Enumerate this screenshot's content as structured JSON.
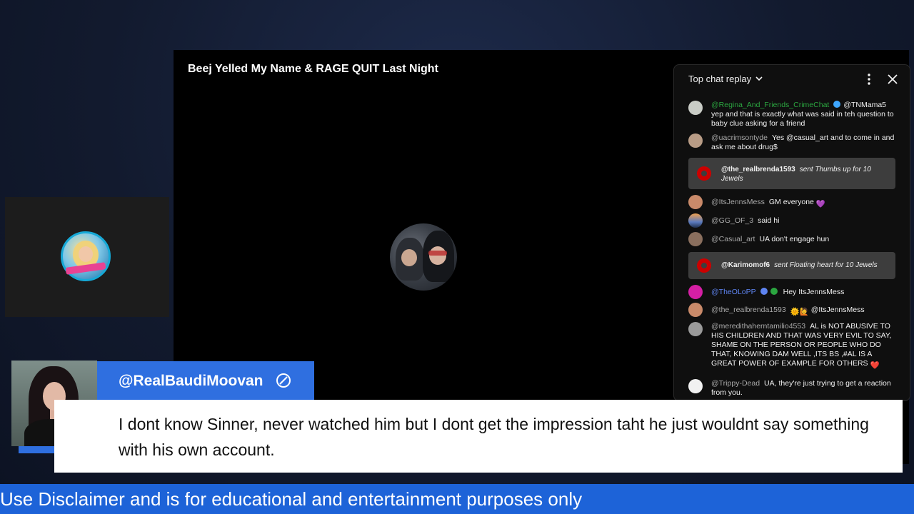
{
  "video": {
    "title": "Beej Yelled My Name & RAGE QUIT Last Night"
  },
  "chat": {
    "header_title": "Top chat replay",
    "header_icons": [
      "chevron-down-icon",
      "more-vert-icon",
      "close-icon"
    ],
    "messages": [
      {
        "author": "@Regina_And_Friends_CrimeChat",
        "text": "@TNMama5 yep and that is exactly what was said in teh question to baby clue asking for a friend"
      },
      {
        "author": "@uacrimsontyde",
        "text": "Yes @casual_art and to come in and ask me about drug$"
      },
      {
        "author": "@the_realbrenda1593",
        "text": "sent Thumbs up for 10 Jewels"
      },
      {
        "author": "@ItsJennsMess",
        "text": "GM everyone",
        "emoji": "💜"
      },
      {
        "author": "@GG_OF_3",
        "text": "said hi"
      },
      {
        "author": "@Casual_art",
        "text": "UA don't engage hun"
      },
      {
        "author": "@Karimomof6",
        "text": "sent Floating heart for 10 Jewels"
      },
      {
        "author": "@TheOLoPP",
        "text": "Hey ItsJennsMess"
      },
      {
        "author": "@the_realbrenda1593",
        "emoji": "🌞🙋",
        "text": "@ItsJennsMess"
      },
      {
        "author": "@meredithaherntamilio4553",
        "text": "AL is NOT ABUSIVE TO HIS CHILDREN AND THAT WAS VERY EVIL TO SAY, SHAME ON THE PERSON OR PEOPLE WHO DO THAT, KNOWING DAM WELL ,ITS BS ,#AL IS A GREAT POWER OF EXAMPLE FOR OTHERS",
        "emoji": "❤️"
      },
      {
        "author": "@Trippy-Dead",
        "text": "UA, they're just trying to get a reaction from you."
      }
    ]
  },
  "overlay": {
    "name_tag": "@RealBaudiMoovan",
    "caption": "I dont know Sinner, never watched him but I dont get the impression taht he just wouldnt say something with his own account.",
    "ticker": "Use Disclaimer and is for educational and entertainment purposes only"
  },
  "colors": {
    "accent_blue": "#2f6fe0",
    "ticker_blue": "#1d63d8",
    "chat_bg": "#0f0f0f",
    "jewel_bg": "#3d3d3d"
  }
}
